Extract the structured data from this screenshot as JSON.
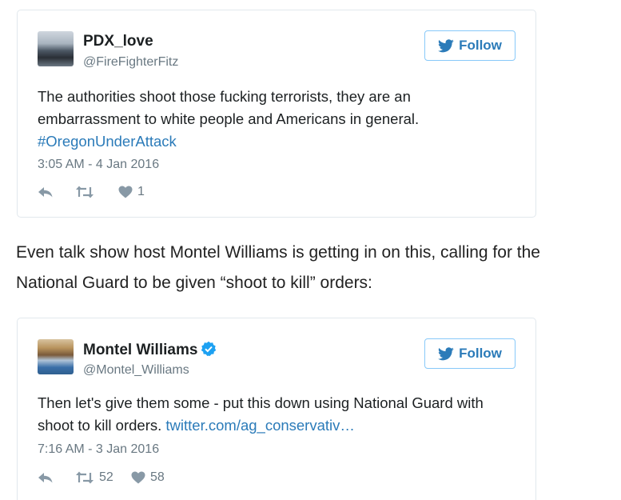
{
  "tweets": [
    {
      "name": "PDX_love",
      "handle": "@FireFighterFitz",
      "follow_label": "Follow",
      "text": "The authorities shoot those fucking terrorists, they are an embarrassment to white people and Americans in general.",
      "hashtag": "#OregonUnderAttack",
      "timestamp": "3:05 AM - 4 Jan 2016",
      "retweets": "",
      "likes": "1"
    },
    {
      "name": "Montel Williams",
      "handle": "@Montel_Williams",
      "follow_label": "Follow",
      "text": "Then let's give them some - put this down using National Guard with shoot to kill orders.",
      "link": "twitter.com/ag_conservativ…",
      "timestamp": "7:16 AM - 3 Jan 2016",
      "retweets": "52",
      "likes": "58"
    }
  ],
  "article": {
    "paragraph": "Even talk show host Montel Williams is getting in on this, calling for the National Guard to be given “shoot to kill” orders:"
  },
  "colors": {
    "link": "#2b7bb9",
    "follow_border": "#88c9f9",
    "verified": "#1da1f2",
    "muted": "#697882",
    "icon": "#8899a6"
  },
  "icons": [
    "twitter-bird-icon",
    "verified-badge-icon",
    "reply-icon",
    "retweet-icon",
    "heart-icon"
  ]
}
